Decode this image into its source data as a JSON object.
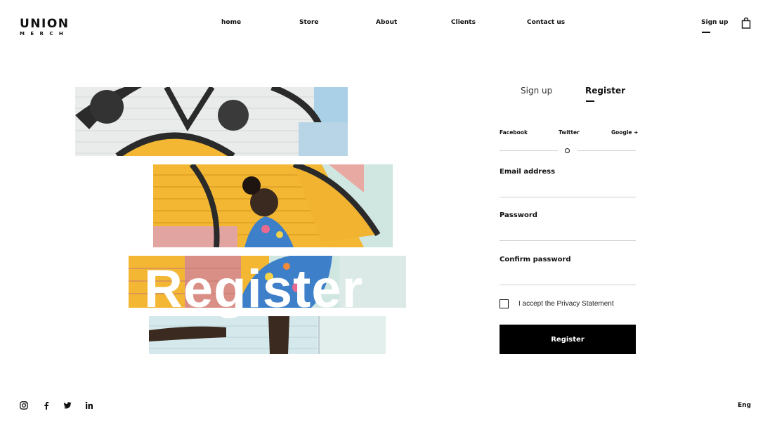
{
  "brand": {
    "name": "UNION",
    "tagline": "MERCH"
  },
  "nav": {
    "items": [
      {
        "label": "home"
      },
      {
        "label": "Store"
      },
      {
        "label": "About"
      },
      {
        "label": "Clients"
      },
      {
        "label": "Contact us"
      }
    ],
    "signup_label": "Sign up",
    "cart_icon": "shopping-bag-icon"
  },
  "hero": {
    "title": "Register"
  },
  "form": {
    "tabs": [
      {
        "label": "Sign up",
        "active": false
      },
      {
        "label": "Register",
        "active": true
      }
    ],
    "social": [
      {
        "label": "Facebook"
      },
      {
        "label": "Twitter"
      },
      {
        "label": "Google +"
      }
    ],
    "fields": [
      {
        "label": "Email address",
        "value": "",
        "placeholder": ""
      },
      {
        "label": "Password",
        "value": "",
        "placeholder": ""
      },
      {
        "label": "Confirm password",
        "value": "",
        "placeholder": ""
      }
    ],
    "privacy_label": "I accept the Privacy Statement",
    "privacy_checked": false,
    "submit_label": "Register"
  },
  "footer": {
    "social_icons": [
      "instagram-icon",
      "facebook-icon",
      "twitter-icon",
      "linkedin-icon"
    ],
    "language": "Eng"
  },
  "colors": {
    "accent": "#000000",
    "mural_yellow": "#f3b733",
    "mural_mint": "#cfe6e1",
    "mural_pink": "#e8a9a3",
    "mural_blue": "#3d7fc8"
  }
}
